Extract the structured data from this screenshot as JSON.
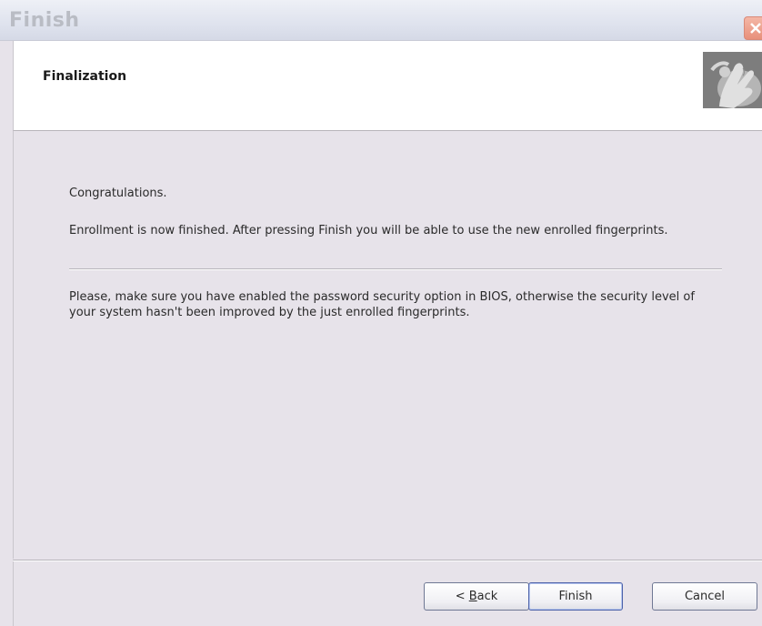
{
  "window": {
    "title": "Finish"
  },
  "header": {
    "heading": "Finalization",
    "image_icon": "fingerprint-hand-icon"
  },
  "content": {
    "congratulations": "Congratulations.",
    "enrollment_text": "Enrollment is now finished.  After pressing Finish you will be able to use the new enrolled fingerprints.",
    "bios_text": "Please, make sure you have enabled the password security option in BIOS, otherwise the security level of your system hasn't been improved by the just enrolled fingerprints."
  },
  "buttons": {
    "back_prefix": "< ",
    "back_mnemonic": "B",
    "back_rest": "ack",
    "finish": "Finish",
    "cancel": "Cancel"
  },
  "colors": {
    "dialog_background": "#e7e3ea",
    "header_background": "#ffffff",
    "close_button": "#e8907b"
  }
}
